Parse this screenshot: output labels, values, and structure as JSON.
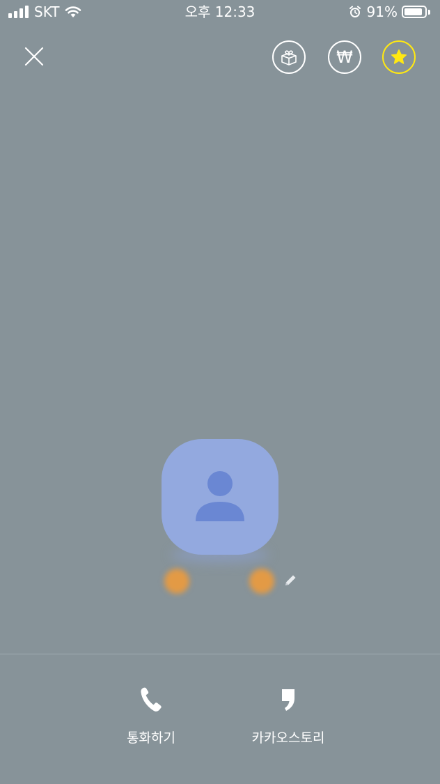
{
  "status_bar": {
    "carrier": "SKT",
    "time": "오후 12:33",
    "battery_percent": "91%",
    "battery_level": 0.91,
    "icons": [
      "signal-icon",
      "wifi-icon",
      "alarm-icon",
      "battery-icon"
    ]
  },
  "top_actions": {
    "close_icon": "close-icon",
    "gift_icon": "gift-box-icon",
    "pay_symbol": "₩",
    "favorite_icon": "star-icon"
  },
  "profile": {
    "name": "",
    "avatar_icon": "person-icon",
    "edit_icon": "pencil-icon"
  },
  "bottom_actions": {
    "call_label": "통화하기",
    "story_label": "카카오스토리"
  },
  "colors": {
    "background": "#879399",
    "avatar_bg": "#93a9df",
    "avatar_figure": "#6a87d3",
    "favorite_accent": "#ffe812",
    "divider": "#a1abb1"
  }
}
